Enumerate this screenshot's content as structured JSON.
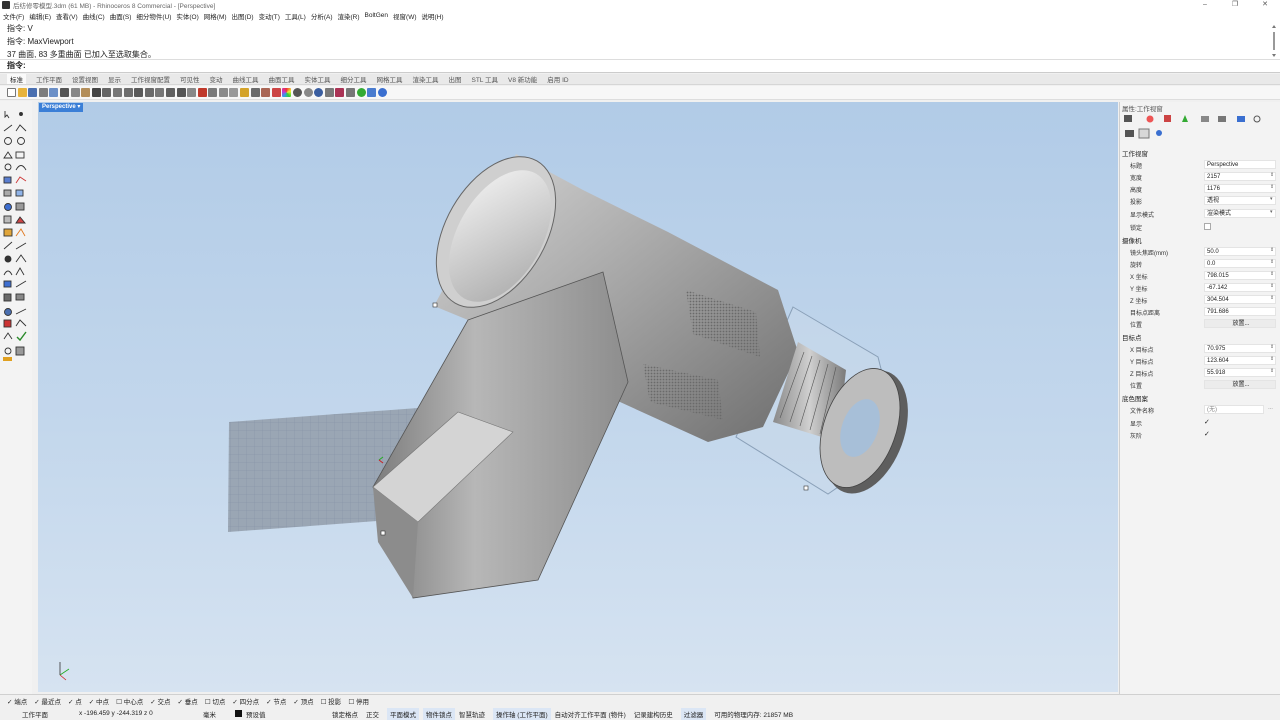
{
  "window": {
    "title": "后纺修零模型.3dm (61 MB) - Rhinoceros 8 Commercial - [Perspective]",
    "controls": [
      "–",
      "❐",
      "✕"
    ]
  },
  "menu": [
    "文件(F)",
    "编辑(E)",
    "查看(V)",
    "曲线(C)",
    "曲面(S)",
    "细分物件(U)",
    "实体(O)",
    "网格(M)",
    "出图(D)",
    "变动(T)",
    "工具(L)",
    "分析(A)",
    "渲染(R)",
    "BoltGen",
    "视窗(W)",
    "说明(H)"
  ],
  "command_history": [
    "指令: V",
    "指令: MaxViewport",
    "37 曲面, 83 多重曲面 已加入至选取集合。"
  ],
  "command_prompt": "指令:",
  "toolbar_tabs": [
    "标准",
    "工作平面",
    "设置视图",
    "显示",
    "工作视窗配置",
    "可见性",
    "变动",
    "曲线工具",
    "曲面工具",
    "实体工具",
    "细分工具",
    "网格工具",
    "渲染工具",
    "出图",
    "STL 工具",
    "V8 新功能",
    "启用 ID"
  ],
  "viewport": {
    "label": "Perspective ▾",
    "name": "Perspective"
  },
  "properties": {
    "panel_title": "属性:工作视窗",
    "section_viewport": "工作视窗",
    "title_label": "标题",
    "title_value": "Perspective",
    "width_label": "宽度",
    "width_value": "2157",
    "height_label": "高度",
    "height_value": "1176",
    "projection_label": "投影",
    "projection_value": "透视",
    "display_mode_label": "显示模式",
    "display_mode_value": "渲染模式",
    "locked_label": "锁定",
    "section_camera": "摄像机",
    "lens_label": "镜头焦距(mm)",
    "lens_value": "50.0",
    "rotation_label": "旋转",
    "rotation_value": "0.0",
    "x_label": "X 坐标",
    "x_value": "798.015",
    "y_label": "Y 坐标",
    "y_value": "-67.142",
    "z_label": "Z 坐标",
    "z_value": "304.504",
    "target_dist_label": "目标点距离",
    "target_dist_value": "791.686",
    "position_label": "位置",
    "place_button": "放置...",
    "section_target": "目标点",
    "tx_label": "X 目标点",
    "tx_value": "70.975",
    "ty_label": "Y 目标点",
    "ty_value": "123.604",
    "tz_label": "Z 目标点",
    "tz_value": "55.918",
    "tposition_label": "位置",
    "tplace_button": "放置...",
    "section_wallpaper": "底色图案",
    "filename_label": "文件名称",
    "filename_value": "(无)",
    "show_label": "显示",
    "gray_label": "灰阶"
  },
  "osnaps": [
    "✓ 端点",
    "✓ 最近点",
    "✓ 点",
    "✓ 中点",
    "☐ 中心点",
    "✓ 交点",
    "✓ 垂点",
    "☐ 切点",
    "✓ 四分点",
    "✓ 节点",
    "✓ 顶点",
    "☐ 投影",
    "☐ 停用"
  ],
  "status": {
    "cplane": "工作平面",
    "coords": "x -196.459  y -244.319  z 0",
    "units": "毫米",
    "layer": "预设值",
    "lock_grid": "锁定格点",
    "ortho": "正交",
    "planar": "平面模式",
    "osnap": "物件锁点",
    "smarttrack": "智慧轨迹",
    "gumball": "操作轴 (工作平面)",
    "autoalign": "自动对齐工作平面 (物件)",
    "history": "记录建构历史",
    "filter": "过滤器",
    "memory": "可用的物理内存: 21857 MB"
  },
  "colors": {
    "accent": "#3b7fd7",
    "viewport_top": "#b1cbe7",
    "viewport_bottom": "#d6e3f1",
    "model_gray": "#a9a9a9"
  }
}
